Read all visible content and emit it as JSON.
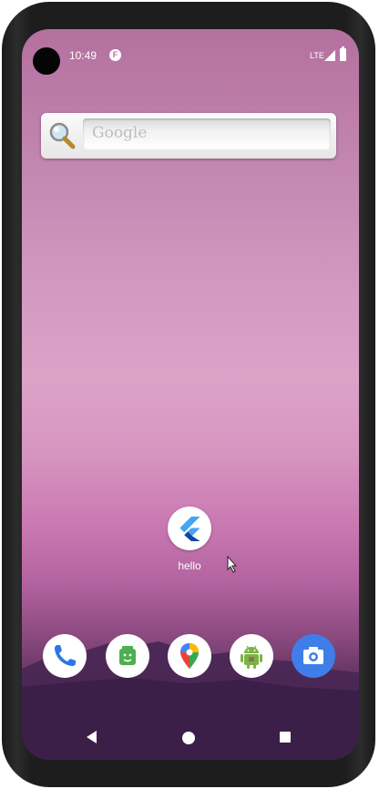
{
  "status_bar": {
    "time": "10:49",
    "notification_icon": "flutter-notification-icon",
    "network": "LTE",
    "signal_icon": "signal-icon",
    "battery_icon": "battery-icon"
  },
  "search_widget": {
    "placeholder": "Google",
    "icon": "magnifier-icon"
  },
  "home_screen": {
    "apps": [
      {
        "label": "hello",
        "icon": "flutter-icon"
      }
    ]
  },
  "dock": {
    "items": [
      {
        "name": "Phone",
        "icon": "phone-icon"
      },
      {
        "name": "Store",
        "icon": "store-icon"
      },
      {
        "name": "Maps",
        "icon": "maps-icon"
      },
      {
        "name": "Android",
        "icon": "android-icon"
      },
      {
        "name": "Camera",
        "icon": "camera-icon"
      }
    ]
  },
  "nav_bar": {
    "back_icon": "back-icon",
    "home_icon": "home-icon",
    "recents_icon": "recents-icon"
  },
  "colors": {
    "wallpaper_top": "#b4709f",
    "wallpaper_mid": "#dca2c7",
    "wallpaper_bottom": "#3c2046",
    "camera_accent": "#3f7ee8",
    "flutter_blue": "#42a5f5",
    "flutter_dark": "#0d47a1"
  }
}
